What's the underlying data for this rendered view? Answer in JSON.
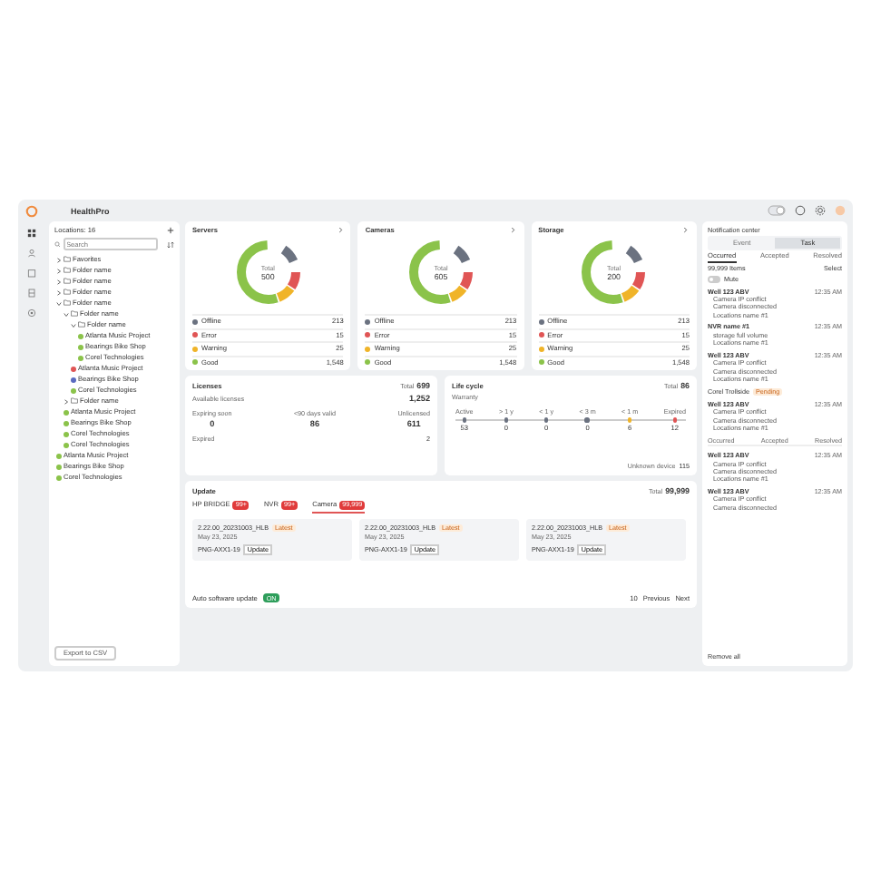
{
  "app": {
    "title": "HealthPro"
  },
  "sidebar": {
    "title": "Locations: 16",
    "search": {
      "placeholder": "Search"
    },
    "tree": [
      {
        "kind": "folder",
        "label": "Favorites",
        "expanded": false
      },
      {
        "kind": "folder",
        "label": "Folder name",
        "expanded": false
      },
      {
        "kind": "folder",
        "label": "Folder name",
        "expanded": false
      },
      {
        "kind": "folder",
        "label": "Folder name",
        "expanded": false
      },
      {
        "kind": "folder",
        "label": "Folder name",
        "expanded": true,
        "children": [
          {
            "kind": "folder",
            "label": "Folder name",
            "expanded": true,
            "children": [
              {
                "kind": "folder",
                "label": "Folder name",
                "expanded": true,
                "children": [
                  {
                    "kind": "site",
                    "label": "Atlanta Music Project",
                    "color": "#8bc34a"
                  },
                  {
                    "kind": "site",
                    "label": "Bearings Bike Shop",
                    "color": "#8bc34a"
                  },
                  {
                    "kind": "site",
                    "label": "Corel Technologies",
                    "color": "#8bc34a"
                  }
                ]
              },
              {
                "kind": "site",
                "label": "Atlanta Music Project",
                "color": "#e05555"
              },
              {
                "kind": "site",
                "label": "Bearings Bike Shop",
                "color": "#5b6bc0"
              },
              {
                "kind": "site",
                "label": "Corel Technologies",
                "color": "#8bc34a"
              }
            ]
          },
          {
            "kind": "folder",
            "label": "Folder name",
            "expanded": false
          },
          {
            "kind": "site",
            "label": "Atlanta Music Project",
            "color": "#8bc34a"
          },
          {
            "kind": "site",
            "label": "Bearings Bike Shop",
            "color": "#8bc34a"
          },
          {
            "kind": "site",
            "label": "Corel Technologies",
            "color": "#8bc34a"
          },
          {
            "kind": "site",
            "label": "Corel Technologies",
            "color": "#8bc34a"
          }
        ]
      },
      {
        "kind": "site",
        "label": "Atlanta Music Project",
        "color": "#8bc34a"
      },
      {
        "kind": "site",
        "label": "Bearings Bike Shop",
        "color": "#8bc34a"
      },
      {
        "kind": "site",
        "label": "Corel Technologies",
        "color": "#8bc34a"
      }
    ],
    "export_button": "Export to CSV"
  },
  "device_cards": [
    {
      "title": "Servers",
      "total_label": "Total",
      "total": "500",
      "legend": [
        {
          "label": "Offline",
          "value": "213",
          "color": "#6b7280"
        },
        {
          "label": "Error",
          "value": "15",
          "color": "#e05555"
        },
        {
          "label": "Warning",
          "value": "25",
          "color": "#f0b429"
        },
        {
          "label": "Good",
          "value": "1,548",
          "color": "#8bc34a"
        }
      ]
    },
    {
      "title": "Cameras",
      "total_label": "Total",
      "total": "605",
      "legend": [
        {
          "label": "Offline",
          "value": "213",
          "color": "#6b7280"
        },
        {
          "label": "Error",
          "value": "15",
          "color": "#e05555"
        },
        {
          "label": "Warning",
          "value": "25",
          "color": "#f0b429"
        },
        {
          "label": "Good",
          "value": "1,548",
          "color": "#8bc34a"
        }
      ]
    },
    {
      "title": "Storage",
      "total_label": "Total",
      "total": "200",
      "legend": [
        {
          "label": "Offline",
          "value": "213",
          "color": "#6b7280"
        },
        {
          "label": "Error",
          "value": "15",
          "color": "#e05555"
        },
        {
          "label": "Warning",
          "value": "25",
          "color": "#f0b429"
        },
        {
          "label": "Good",
          "value": "1,548",
          "color": "#8bc34a"
        }
      ]
    }
  ],
  "licenses": {
    "title": "Licenses",
    "total_label": "Total",
    "total": "699",
    "available_label": "Available licenses",
    "available": "1,252",
    "stats": [
      {
        "label": "Expiring soon",
        "value": "0"
      },
      {
        "label": "<90 days valid",
        "value": "86"
      },
      {
        "label": "Unlicensed",
        "value": "611"
      }
    ],
    "expired_label": "Expired",
    "expired": "2"
  },
  "life_cycle": {
    "title": "Life cycle",
    "total_label": "Total",
    "total": "86",
    "subtitle": "Warranty",
    "points": [
      {
        "label": "Active",
        "value": "53",
        "color": "#6b7280"
      },
      {
        "label": "> 1 y",
        "value": "0",
        "color": "#6b7280"
      },
      {
        "label": "< 1 y",
        "value": "0",
        "color": "#6b7280"
      },
      {
        "label": "< 3 m",
        "value": "0",
        "color": "#6b7280"
      },
      {
        "label": "< 1 m",
        "value": "6",
        "color": "#f0b429"
      },
      {
        "label": "Expired",
        "value": "12",
        "color": "#e05555"
      }
    ],
    "unknown_label": "Unknown device",
    "unknown": "115"
  },
  "update": {
    "title": "Update",
    "total_label": "Total",
    "total": "99,999",
    "tabs": [
      {
        "label": "HP BRIDGE",
        "badge": "99+",
        "selected": false
      },
      {
        "label": "NVR",
        "badge": "99+",
        "selected": false
      },
      {
        "label": "Camera",
        "badge": "99,999",
        "selected": true
      }
    ],
    "versions": [
      {
        "version": "2.22.00_20231003_HLB",
        "tag": "Latest",
        "date": "May 23, 2025",
        "model": "PNG-AXX1-19",
        "action": "Update"
      },
      {
        "version": "2.22.00_20231003_HLB",
        "tag": "Latest",
        "date": "May 23, 2025",
        "model": "PNG-AXX1-19",
        "action": "Update"
      },
      {
        "version": "2.22.00_20231003_HLB",
        "tag": "Latest",
        "date": "May 23, 2025",
        "model": "PNG-AXX1-19",
        "action": "Update"
      }
    ],
    "auto_label": "Auto software update",
    "auto_badge": "ON",
    "page_size": "10",
    "prev": "Previous",
    "next": "Next"
  },
  "notifications": {
    "title": "Notification center",
    "segments": [
      {
        "label": "Event",
        "selected": false
      },
      {
        "label": "Task",
        "selected": true
      }
    ],
    "tabs": [
      {
        "label": "Occurred",
        "selected": true
      },
      {
        "label": "Accepted",
        "selected": false
      },
      {
        "label": "Resolved",
        "selected": false
      }
    ],
    "count": "99,999 Items",
    "select": "Select",
    "mute_label": "Mute",
    "mute": false,
    "items": [
      {
        "kind": "event",
        "title": "Well 123 ABV",
        "time": "12:35 AM",
        "lines": [
          "Camera IP conflict",
          "Camera disconnected"
        ],
        "location": "Locations name #1"
      },
      {
        "kind": "event",
        "title": "NVR name #1",
        "time": "12:35 AM",
        "lines": [
          "storage full volume"
        ],
        "location": "Locations name #1"
      },
      {
        "kind": "event",
        "title": "Well 123 ABV",
        "time": "12:35 AM",
        "lines": [
          "Camera IP conflict",
          "Camera disconnected"
        ],
        "location": "Locations name #1"
      },
      {
        "kind": "group",
        "title": "Corel Trollside",
        "badge": "Pending"
      },
      {
        "kind": "event",
        "title": "Well 123 ABV",
        "time": "12:35 AM",
        "lines": [
          "Camera IP conflict",
          "Camera disconnected"
        ],
        "location": "Locations name #1"
      },
      {
        "kind": "tabs",
        "labels": [
          "Occurred",
          "Accepted",
          "Resolved"
        ]
      },
      {
        "kind": "event",
        "title": "Well 123 ABV",
        "time": "12:35 AM",
        "lines": [
          "Camera IP conflict",
          "Camera disconnected"
        ],
        "location": "Locations name #1"
      },
      {
        "kind": "event",
        "title": "Well 123 ABV",
        "time": "12:35 AM",
        "lines": [
          "Camera IP conflict",
          "Camera disconnected"
        ]
      }
    ],
    "remove_all": "Remove all"
  }
}
